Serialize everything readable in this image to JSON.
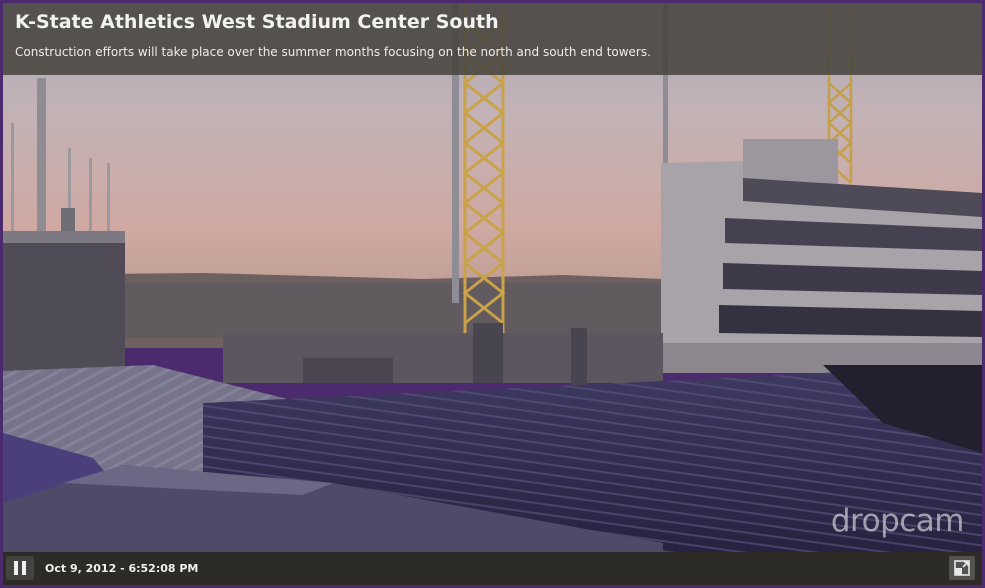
{
  "camera": {
    "title": "K-State Athletics West Stadium Center South",
    "description": "Construction efforts will take place over the summer months focusing on the north and south end towers."
  },
  "player": {
    "watermark": "dropcam",
    "timestamp": "Oct 9, 2012 - 6:52:08 PM",
    "state": "playing"
  },
  "icons": {
    "pause": "pause-icon",
    "fullscreen": "fullscreen-icon"
  },
  "colors": {
    "border": "#4b2a6e",
    "header_bg": "#46423c",
    "controlbar_bg": "#2d2b28"
  }
}
